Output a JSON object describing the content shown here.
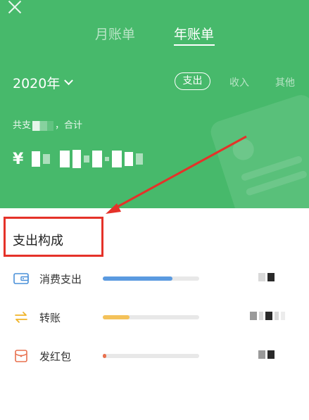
{
  "header": {
    "close_label": "×",
    "tabs": [
      {
        "label": "月账单",
        "active": false
      },
      {
        "label": "年账单",
        "active": true
      }
    ],
    "year_label": "2020年",
    "type_tabs": [
      {
        "label": "支出",
        "active": true
      },
      {
        "label": "收入",
        "active": false
      },
      {
        "label": "其他",
        "active": false
      }
    ],
    "summary_prefix": "共支",
    "summary_suffix": "，合计",
    "total_currency": "¥",
    "accent_color": "#47b96b"
  },
  "composition": {
    "title": "支出构成",
    "highlight_color": "#e53229",
    "items": [
      {
        "label": "消费支出",
        "icon": "wallet-icon",
        "share": 0.72,
        "color": "#5a9ae0"
      },
      {
        "label": "转账",
        "icon": "transfer-arrows-icon",
        "share": 0.28,
        "color": "#f4c25a"
      },
      {
        "label": "发红包",
        "icon": "red-envelope-icon",
        "share": 0.03,
        "color": "#e8714f"
      }
    ]
  }
}
